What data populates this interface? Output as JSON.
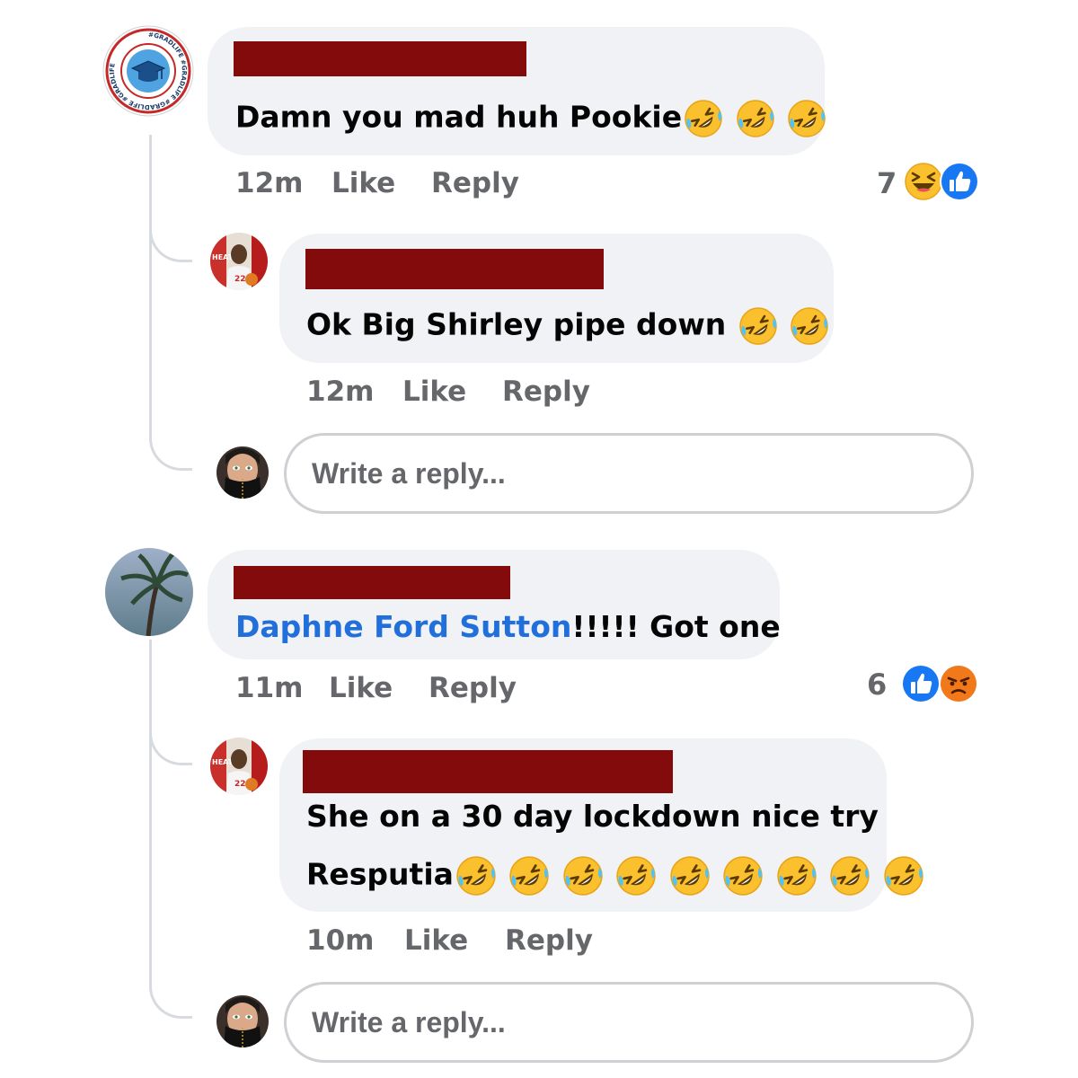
{
  "colors": {
    "bubble_bg": "#f0f2f5",
    "redaction": "#830b0b",
    "meta_text": "#65676b",
    "mention": "#216fdb",
    "like_blue": "#1877f2",
    "thread_line": "#d7dade"
  },
  "comments": [
    {
      "avatar": "gradlife-badge-avatar",
      "badge_text": "#GRADLIFE #GRADLIFE #GRADLIFE #GRADLIFE",
      "text": "Damn you mad huh Pookie",
      "emoji_count": 3,
      "time": "12m",
      "like_label": "Like",
      "reply_label": "Reply",
      "reaction_count": "7",
      "reactions": [
        "laugh-emoji",
        "like-icon"
      ]
    },
    {
      "avatar": "basketball-player-avatar",
      "text": "Ok Big Shirley pipe down ",
      "emoji_count": 2,
      "time": "12m",
      "like_label": "Like",
      "reply_label": "Reply"
    },
    {
      "avatar": "palm-tree-avatar",
      "mention": "Daphne Ford Sutton",
      "text": "!!!!! Got one",
      "time": "11m",
      "like_label": "Like",
      "reply_label": "Reply",
      "reaction_count": "6",
      "reactions": [
        "like-icon",
        "angry-emoji"
      ]
    },
    {
      "avatar": "basketball-player-avatar",
      "text_line1": "She on a 30 day lockdown nice try",
      "text_line2": "Resputia",
      "emoji_count": 9,
      "time": "10m",
      "like_label": "Like",
      "reply_label": "Reply"
    }
  ],
  "reply_boxes": [
    {
      "placeholder": "Write a reply..."
    },
    {
      "placeholder": "Write a reply..."
    }
  ],
  "icons": {
    "rofl": "rolling-on-floor-laughing-emoji",
    "laugh": "laugh-emoji",
    "like": "like-icon",
    "angry": "angry-emoji"
  }
}
